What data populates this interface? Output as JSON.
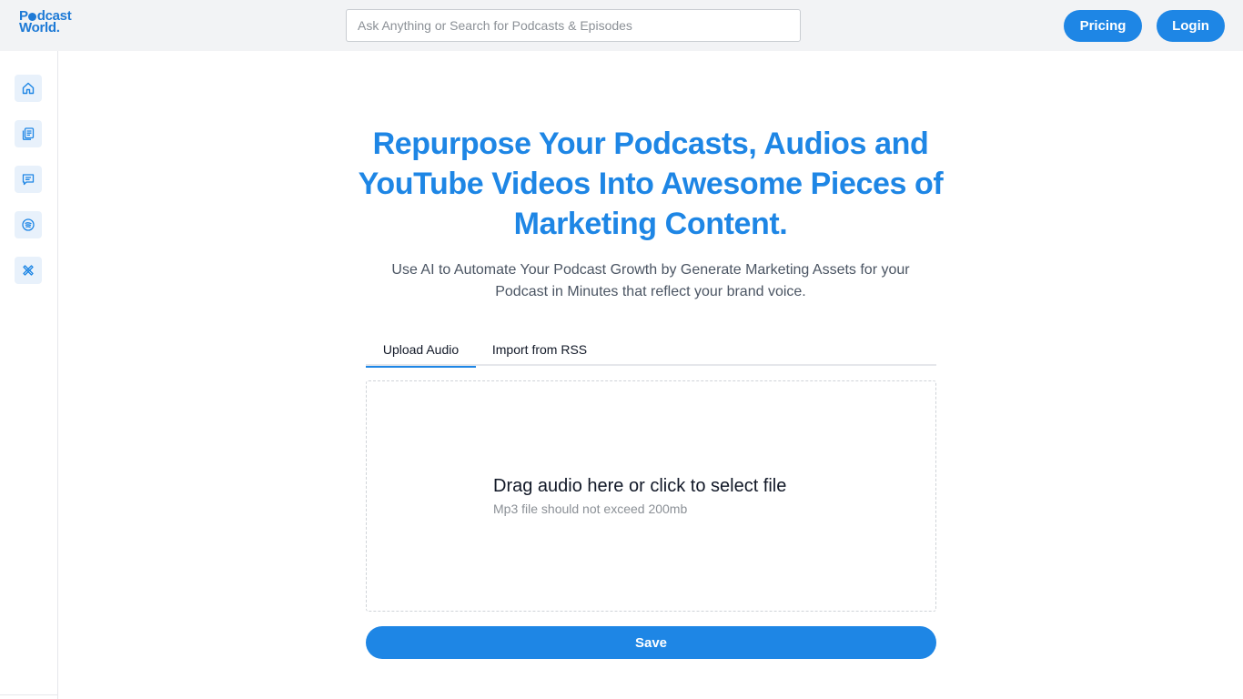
{
  "header": {
    "logo_line1_pre": "P",
    "logo_line1_post": "dcast",
    "logo_line2": "World.",
    "search_placeholder": "Ask Anything or Search for Podcasts & Episodes",
    "pricing_label": "Pricing",
    "login_label": "Login"
  },
  "sidebar": {
    "items": [
      {
        "icon": "home-icon"
      },
      {
        "icon": "documents-icon"
      },
      {
        "icon": "chat-icon"
      },
      {
        "icon": "podcast-feed-icon"
      },
      {
        "icon": "tools-icon"
      }
    ]
  },
  "main": {
    "headline": "Repurpose Your Podcasts, Audios and YouTube Videos Into Awesome Pieces of Marketing Content.",
    "subtitle": "Use AI to Automate Your Podcast Growth by Generate Marketing Assets for your Podcast in Minutes that reflect your brand voice.",
    "tabs": [
      {
        "label": "Upload Audio",
        "active": true
      },
      {
        "label": "Import from RSS",
        "active": false
      }
    ],
    "dropzone": {
      "title": "Drag audio here or click to select file",
      "hint": "Mp3 file should not exceed 200mb"
    },
    "save_label": "Save"
  },
  "colors": {
    "accent": "#1e86e5",
    "topbar_bg": "#f2f3f5",
    "sidebar_btn_bg": "#e8f1fb"
  }
}
